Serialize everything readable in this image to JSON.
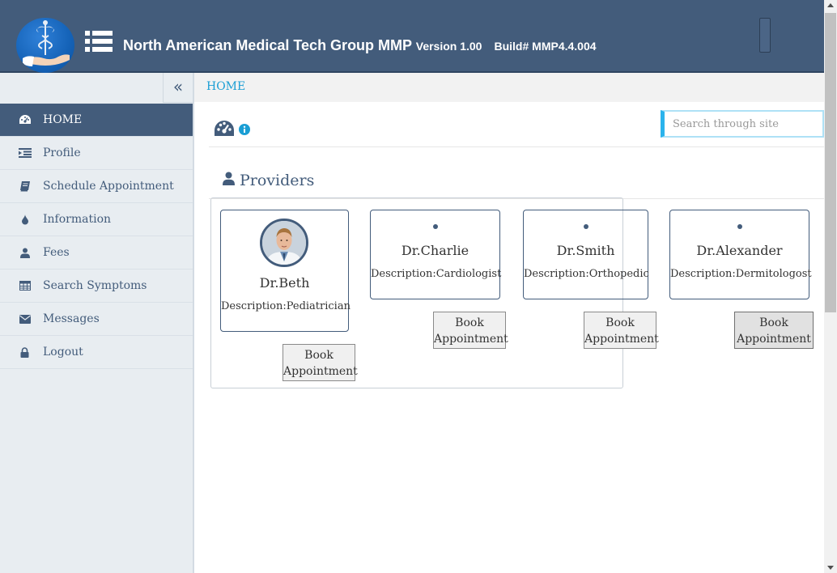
{
  "header": {
    "title": "North American Medical Tech Group MMP",
    "version": "Version 1.00",
    "build": "Build# MMP4.4.004"
  },
  "sidebar": {
    "collapse_icon": "double-chevron-left-icon",
    "items": [
      {
        "label": "HOME",
        "icon": "dashboard-icon",
        "active": true
      },
      {
        "label": "Profile",
        "icon": "indent-icon"
      },
      {
        "label": "Schedule Appointment",
        "icon": "book-icon"
      },
      {
        "label": "Information",
        "icon": "drop-icon"
      },
      {
        "label": "Fees",
        "icon": "user-icon"
      },
      {
        "label": "Search Symptoms",
        "icon": "table-icon"
      },
      {
        "label": "Messages",
        "icon": "envelope-icon"
      },
      {
        "label": "Logout",
        "icon": "lock-icon"
      }
    ]
  },
  "breadcrumb": "HOME",
  "search": {
    "placeholder": "Search through site",
    "value": ""
  },
  "section": {
    "title": "Providers"
  },
  "providers": [
    {
      "name": "Dr.Beth",
      "description": "Description:Pediatrician",
      "button": [
        "Book",
        "Appointment"
      ]
    },
    {
      "name": "Dr.Charlie",
      "description": "Description:Cardiologist",
      "button": [
        "Book",
        "Appointment"
      ]
    },
    {
      "name": "Dr.Smith",
      "description": "Description:Orthopedic",
      "button": [
        "Book",
        "Appointment"
      ]
    },
    {
      "name": "Dr.Alexander",
      "description": "Description:Dermitologost",
      "button": [
        "Book",
        "Appointment"
      ]
    }
  ],
  "colors": {
    "header_bg": "#435c7b",
    "sidebar_bg": "#e8edf1",
    "accent": "#1a9ed4",
    "search_border": "#2ab3ec"
  }
}
